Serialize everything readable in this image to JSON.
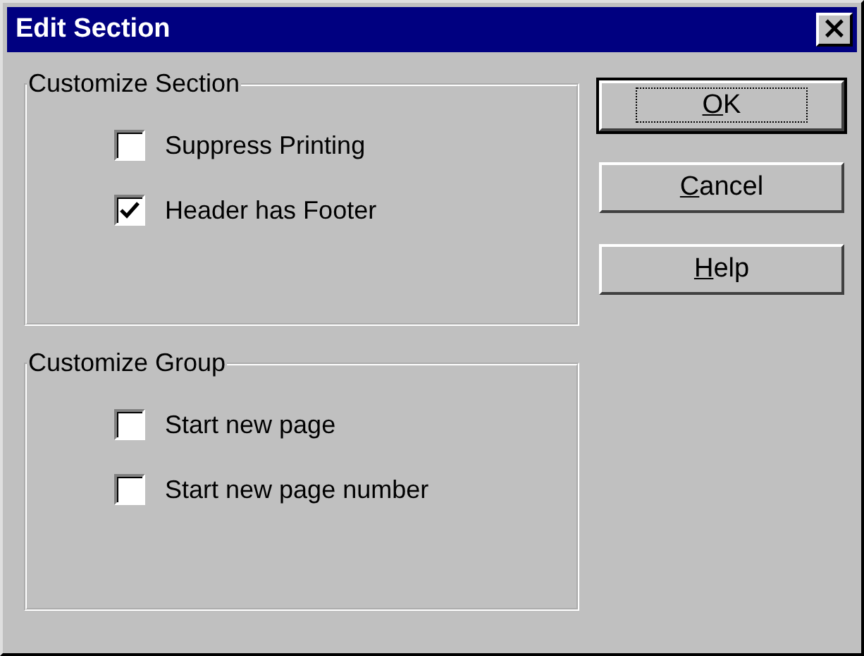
{
  "window": {
    "title": "Edit Section",
    "close": "×"
  },
  "groups": [
    {
      "title": "Customize Section",
      "options": [
        {
          "label": "Suppress Printing",
          "checked": false
        },
        {
          "label": "Header has Footer",
          "checked": true
        }
      ]
    },
    {
      "title": "Customize Group",
      "options": [
        {
          "label": "Start new page",
          "checked": false
        },
        {
          "label": "Start new page number",
          "checked": false
        }
      ]
    }
  ],
  "buttons": [
    {
      "mnemonic": "O",
      "rest": "K",
      "default": true
    },
    {
      "mnemonic": "C",
      "rest": "ancel",
      "default": false
    },
    {
      "mnemonic": "H",
      "rest": "elp",
      "default": false
    }
  ]
}
